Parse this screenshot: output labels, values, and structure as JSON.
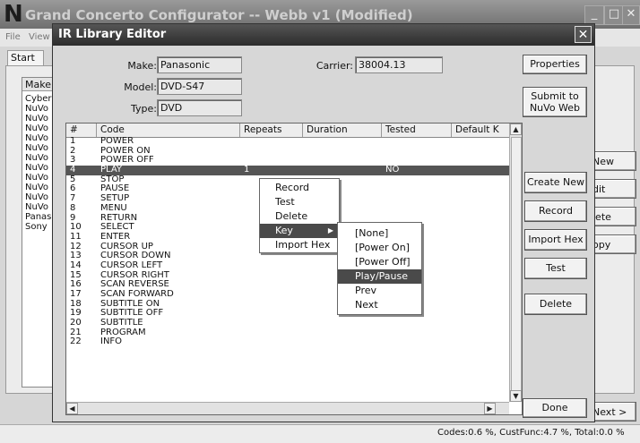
{
  "bg_window": {
    "logo": "N",
    "title": "Grand Concerto Configurator -- Webb v1 (Modified)",
    "menu": [
      "File",
      "View"
    ],
    "start_tab": "Start",
    "make_header": "Make",
    "makes": [
      "Cyberh",
      "NuVo",
      "NuVo",
      "NuVo",
      "NuVo",
      "NuVo",
      "NuVo",
      "NuVo",
      "NuVo",
      "NuVo",
      "NuVo",
      "NuVo",
      "Panaso",
      "Sony"
    ],
    "buttons": {
      "new": "New",
      "edit": "dit",
      "delete": "lete",
      "copy": "opy",
      "next": "Next >"
    },
    "status": "Codes:0.6 %, CustFunc:4.7 %, Total:0.0 %"
  },
  "dialog": {
    "title": "IR Library Editor",
    "close_glyph": "✕",
    "make_label": "Make:",
    "make_value": "Panasonic",
    "model_label": "Model:",
    "model_value": "DVD-S47",
    "type_label": "Type:",
    "type_value": "DVD",
    "carrier_label": "Carrier:",
    "carrier_value": "38004.13",
    "buttons": {
      "properties": "Properties",
      "submit_line1": "Submit to",
      "submit_line2": "NuVo Web",
      "create_new": "Create New",
      "record": "Record",
      "import_hex": "Import Hex",
      "test": "Test",
      "delete": "Delete",
      "done": "Done"
    }
  },
  "grid": {
    "columns": [
      "#",
      "Code",
      "Repeats",
      "Duration",
      "Tested",
      "Default K"
    ],
    "rows": [
      {
        "n": "1",
        "code": "POWER",
        "repeats": "",
        "duration": "",
        "tested": ""
      },
      {
        "n": "2",
        "code": "POWER ON",
        "repeats": "",
        "duration": "",
        "tested": ""
      },
      {
        "n": "3",
        "code": "POWER OFF",
        "repeats": "",
        "duration": "",
        "tested": ""
      },
      {
        "n": "4",
        "code": "PLAY",
        "repeats": "1",
        "duration": "",
        "tested": "NO"
      },
      {
        "n": "5",
        "code": "STOP",
        "repeats": "",
        "duration": "",
        "tested": ""
      },
      {
        "n": "6",
        "code": "PAUSE",
        "repeats": "",
        "duration": "",
        "tested": ""
      },
      {
        "n": "7",
        "code": "SETUP",
        "repeats": "",
        "duration": "",
        "tested": ""
      },
      {
        "n": "8",
        "code": "MENU",
        "repeats": "",
        "duration": "",
        "tested": ""
      },
      {
        "n": "9",
        "code": "RETURN",
        "repeats": "",
        "duration": "",
        "tested": ""
      },
      {
        "n": "10",
        "code": "SELECT",
        "repeats": "",
        "duration": "",
        "tested": ""
      },
      {
        "n": "11",
        "code": "ENTER",
        "repeats": "",
        "duration": "",
        "tested": ""
      },
      {
        "n": "12",
        "code": "CURSOR UP",
        "repeats": "",
        "duration": "",
        "tested": ""
      },
      {
        "n": "13",
        "code": "CURSOR DOWN",
        "repeats": "",
        "duration": "",
        "tested": ""
      },
      {
        "n": "14",
        "code": "CURSOR LEFT",
        "repeats": "",
        "duration": "",
        "tested": ""
      },
      {
        "n": "15",
        "code": "CURSOR RIGHT",
        "repeats": "",
        "duration": "",
        "tested": ""
      },
      {
        "n": "16",
        "code": "SCAN REVERSE",
        "repeats": "",
        "duration": "",
        "tested": ""
      },
      {
        "n": "17",
        "code": "SCAN FORWARD",
        "repeats": "",
        "duration": "",
        "tested": ""
      },
      {
        "n": "18",
        "code": "SUBTITLE ON",
        "repeats": "",
        "duration": "",
        "tested": ""
      },
      {
        "n": "19",
        "code": "SUBTITLE OFF",
        "repeats": "",
        "duration": "",
        "tested": ""
      },
      {
        "n": "20",
        "code": "SUBTITLE",
        "repeats": "",
        "duration": "",
        "tested": ""
      },
      {
        "n": "21",
        "code": "PROGRAM",
        "repeats": "",
        "duration": "",
        "tested": ""
      },
      {
        "n": "22",
        "code": "INFO",
        "repeats": "",
        "duration": "",
        "tested": ""
      }
    ]
  },
  "context_menu": {
    "items": [
      "Record",
      "Test",
      "Delete",
      "Key",
      "Import Hex"
    ],
    "highlighted": "Key"
  },
  "key_submenu": {
    "items": [
      "[None]",
      "[Power On]",
      "[Power Off]",
      "Play/Pause",
      "Prev",
      "Next"
    ],
    "highlighted": "Play/Pause"
  }
}
